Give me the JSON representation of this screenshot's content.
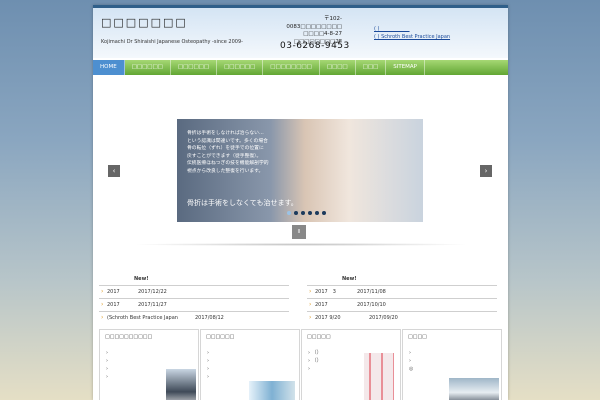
{
  "header": {
    "title": "□□□□□□□",
    "subtitle": "Kojimachi Dr Shiraishi Japanese Osteopathy -since 2009-",
    "address_lines": [
      "〒102-0083□□□□□□□□",
      "□□□□4-8-27",
      "□□□□□□□□2F"
    ],
    "phone": "03-6268-9453",
    "links": [
      "( )____________",
      "( ) Schroth Best Practice Japan"
    ]
  },
  "nav": {
    "items": [
      "HOME",
      "□□□□□□",
      "□□□□□□",
      "□□□□□□",
      "□□□□□□□□",
      "□□□□",
      "□□□",
      "SITEMAP"
    ]
  },
  "slider": {
    "lines": [
      "骨折は手術をしなければ治らない…",
      "という認識は間違いです。多くの場合",
      "骨の転位（ずれ）を徒手での位置に",
      "戻すことができます（徒手整復）。",
      "伝統医療ほねつぎの技を機能解剖学的",
      "視点から改良した整復を行います。"
    ],
    "caption": "骨折は手術をしなくても治せます。",
    "prev": "‹",
    "next": "›",
    "pause": "II"
  },
  "news": {
    "left": {
      "label": "New!",
      "rows": [
        {
          "year": "2017",
          "date": "2017/12/22"
        },
        {
          "year": "2017",
          "date": "2017/11/27"
        },
        {
          "year": "(Schroth Best Practice Japan",
          "date": "2017/08/12"
        }
      ]
    },
    "right": {
      "label": "New!",
      "rows": [
        {
          "year": "2017　3",
          "date": "2017/11/08"
        },
        {
          "year": "2017",
          "date": "2017/10/10"
        },
        {
          "year": "2017 9/20",
          "date": "2017/09/20"
        }
      ]
    }
  },
  "boxes": [
    {
      "title": "□□□□□□□□□□",
      "bullets": [
        "›",
        "›",
        " ",
        "›",
        "›"
      ]
    },
    {
      "title": "□□□□□□",
      "bullets": [
        "›",
        " ",
        "›",
        "›",
        "›"
      ]
    },
    {
      "title": "□□□□□",
      "bullets": [
        " ",
        " ",
        "› （）",
        "› （）",
        "›"
      ]
    },
    {
      "title": "□□□□",
      "bullets": [
        "›",
        " ",
        "›",
        " ",
        "◎"
      ]
    }
  ]
}
